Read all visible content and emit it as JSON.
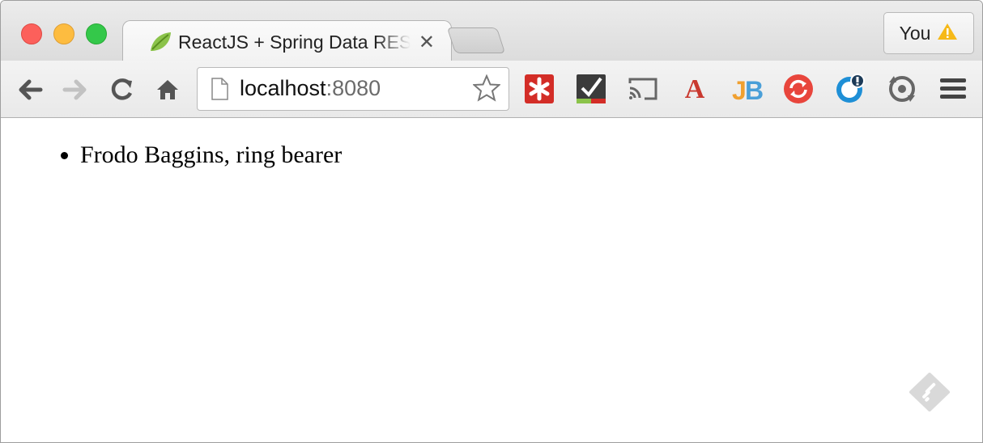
{
  "window": {
    "tab": {
      "title": "ReactJS + Spring Data REST",
      "favicon": "spring-leaf-icon"
    },
    "profile": {
      "label": "You",
      "icon": "warning-icon"
    }
  },
  "toolbar": {
    "buttons": [
      "back-icon",
      "forward-icon",
      "reload-icon",
      "home-icon"
    ],
    "omnibox": {
      "host": "localhost",
      "port": ":8080"
    },
    "extensions": [
      "lastpass-icon",
      "todo-check-icon",
      "cast-icon",
      "dictionary-a-icon",
      "jb-icon",
      "sync-refresh-icon",
      "timer-icon",
      "history-icon"
    ]
  },
  "page": {
    "list": [
      "Frodo Baggins, ring bearer"
    ]
  },
  "colors": {
    "close": "#fc605b",
    "minimize": "#fdbc40",
    "maximize": "#34c84a"
  }
}
